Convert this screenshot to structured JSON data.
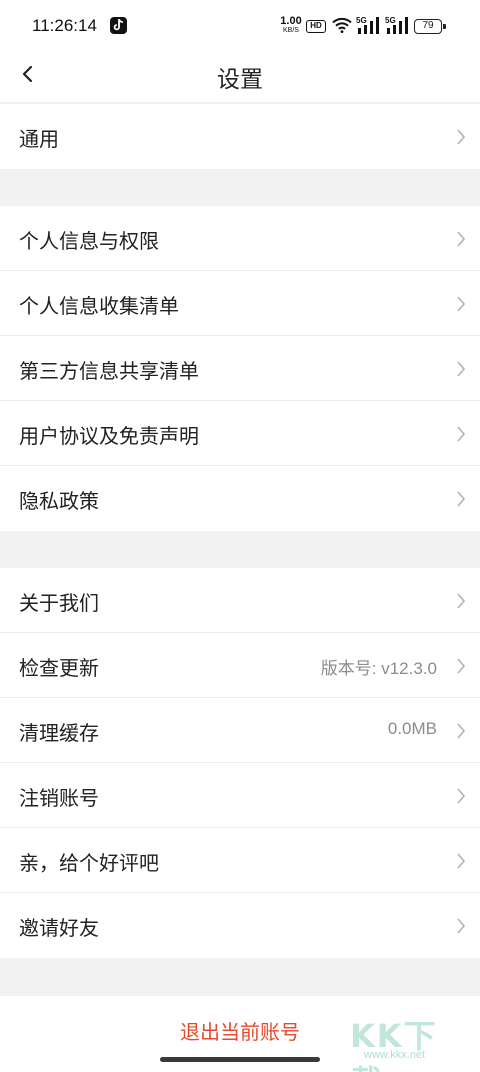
{
  "status_bar": {
    "time": "11:26:14",
    "net_speed_value": "1.00",
    "net_speed_unit": "KB/S",
    "hd_label": "HD",
    "sim1_label": "5G",
    "sim2_label": "5G",
    "battery": "79"
  },
  "header": {
    "title": "设置"
  },
  "groups": [
    {
      "items": [
        {
          "label": "通用",
          "value": ""
        }
      ]
    },
    {
      "items": [
        {
          "label": "个人信息与权限",
          "value": ""
        },
        {
          "label": "个人信息收集清单",
          "value": ""
        },
        {
          "label": "第三方信息共享清单",
          "value": ""
        },
        {
          "label": "用户协议及免责声明",
          "value": ""
        },
        {
          "label": "隐私政策",
          "value": ""
        }
      ]
    },
    {
      "items": [
        {
          "label": "关于我们",
          "value": ""
        },
        {
          "label": "检查更新",
          "value": "版本号: v12.3.0"
        },
        {
          "label": "清理缓存",
          "value": "0.0MB"
        },
        {
          "label": "注销账号",
          "value": ""
        },
        {
          "label": "亲，给个好评吧",
          "value": ""
        },
        {
          "label": "邀请好友",
          "value": ""
        }
      ]
    }
  ],
  "logout_label": "退出当前账号",
  "watermark": {
    "text": "KK下载",
    "url": "www.kkx.net"
  },
  "colors": {
    "accent": "#e64a2e",
    "background": "#f2f2f2"
  }
}
